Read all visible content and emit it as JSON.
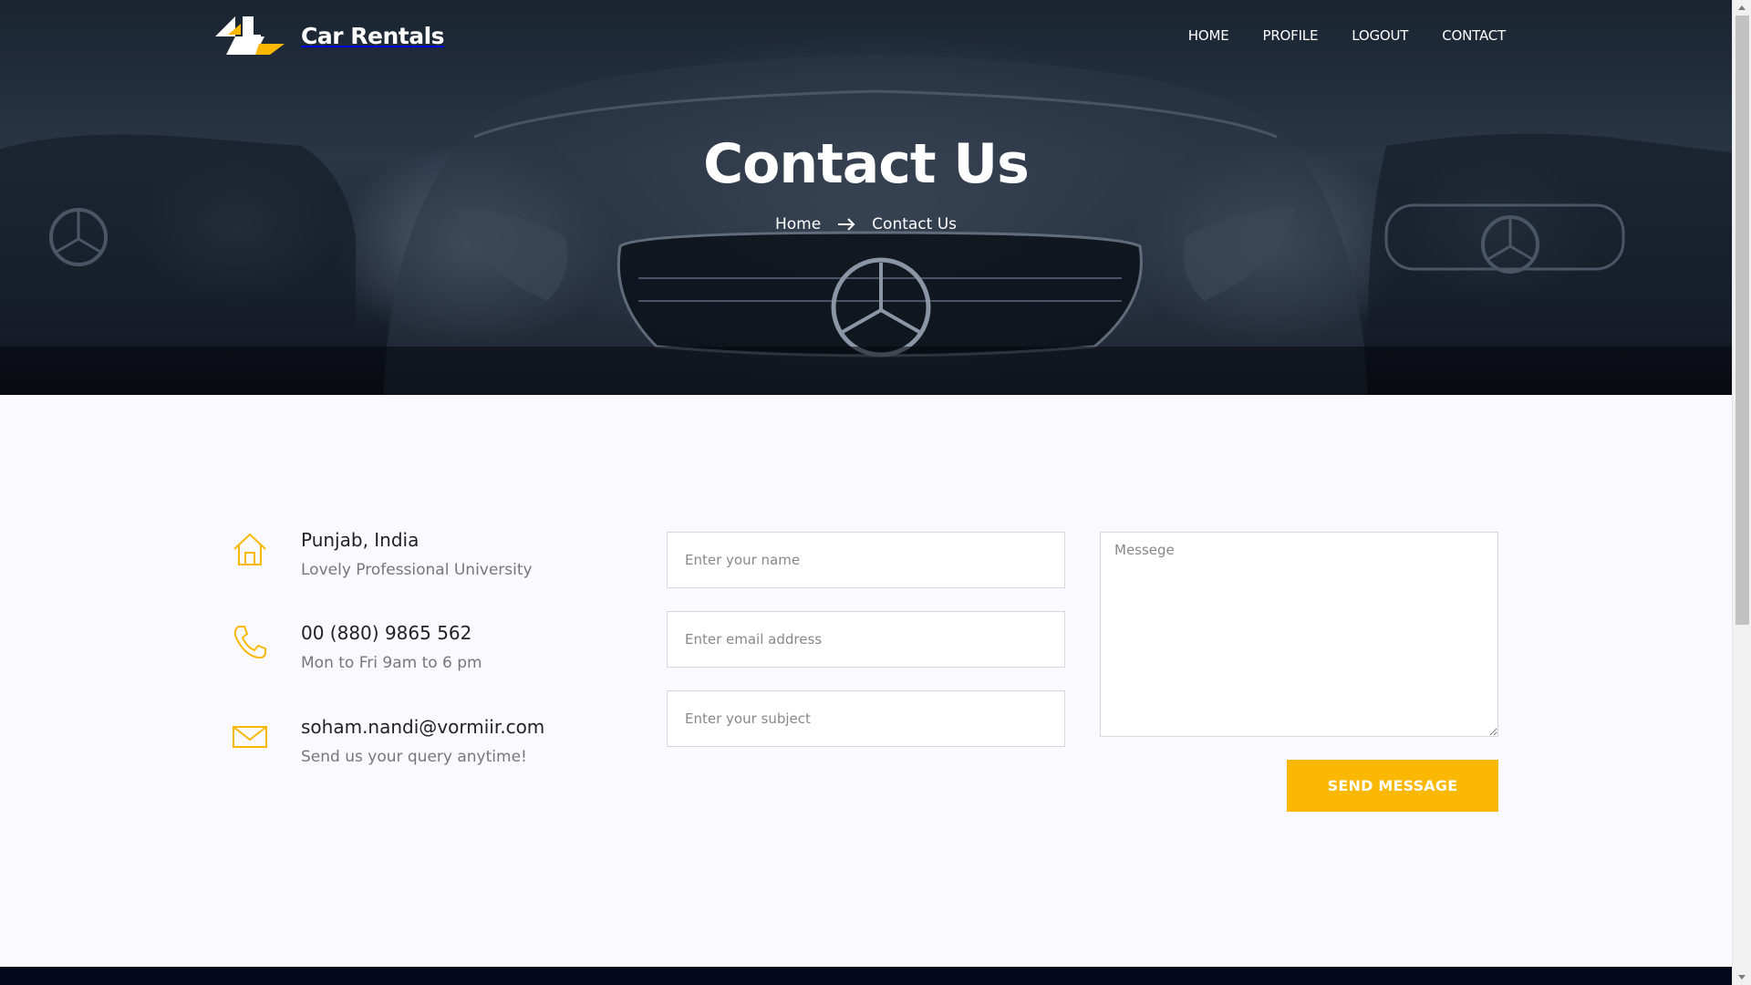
{
  "brand": {
    "name": "Car Rentals",
    "logo_icon": "car-rentals-logo-mark",
    "accent_color": "#fbb802"
  },
  "nav": {
    "items": [
      {
        "label": "HOME"
      },
      {
        "label": "PROFILE"
      },
      {
        "label": "LOGOUT"
      },
      {
        "label": "CONTACT"
      }
    ]
  },
  "hero": {
    "title": "Contact Us",
    "breadcrumb": {
      "home": "Home",
      "separator_icon": "arrow-right-icon",
      "current": "Contact Us"
    }
  },
  "contact_info": [
    {
      "icon": "home-icon",
      "title": "Punjab, India",
      "subtitle": "Lovely Professional University"
    },
    {
      "icon": "phone-icon",
      "title": "00 (880) 9865 562",
      "subtitle": "Mon to Fri 9am to 6 pm"
    },
    {
      "icon": "envelope-icon",
      "title": "soham.nandi@vormiir.com",
      "subtitle": "Send us your query anytime!"
    }
  ],
  "form": {
    "name_placeholder": "Enter your name",
    "email_placeholder": "Enter email address",
    "subject_placeholder": "Enter your subject",
    "message_placeholder": "Messege",
    "submit_label": "SEND MESSAGE"
  }
}
